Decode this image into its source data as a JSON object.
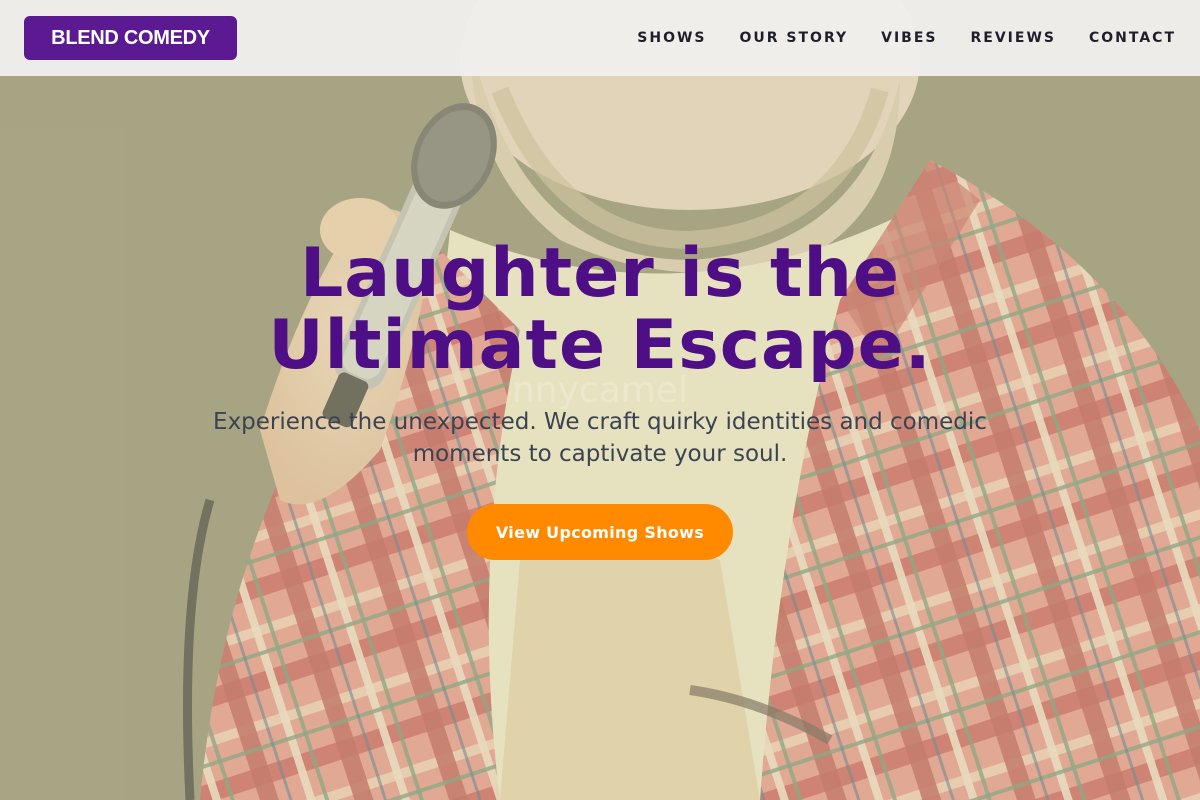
{
  "brand": {
    "name": "BLEND COMEDY",
    "color": "#5b1a91"
  },
  "nav": {
    "links": [
      {
        "label": "SHOWS"
      },
      {
        "label": "OUR STORY"
      },
      {
        "label": "VIBES"
      },
      {
        "label": "REVIEWS"
      },
      {
        "label": "CONTACT"
      }
    ]
  },
  "hero": {
    "title_line_1": "Laughter is the",
    "title_line_2": "Ultimate Escape.",
    "title_color": "#4e0e86",
    "subtitle": "Experience the unexpected. We craft quirky identities and comedic moments to captivate your soul.",
    "cta_label": "View Upcoming Shows",
    "cta_color": "#ff8a00",
    "watermark": "nnycamel",
    "background_image": "comedian-with-microphone-photo"
  }
}
